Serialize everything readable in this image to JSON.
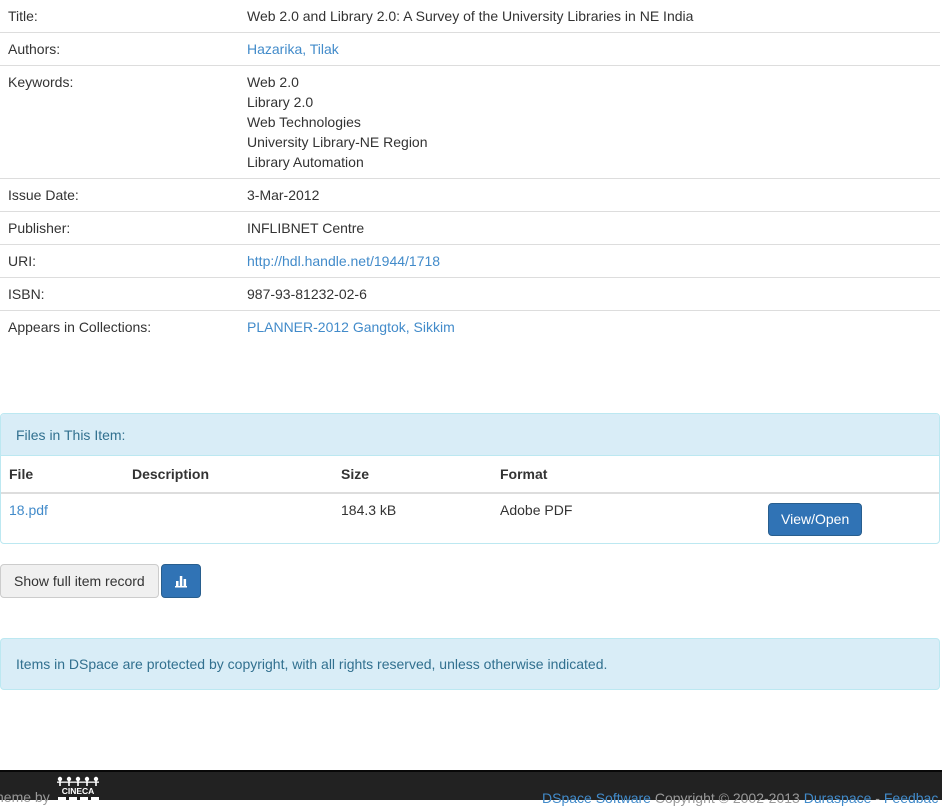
{
  "metadata": {
    "title": {
      "label": "Title:",
      "value": "Web 2.0 and Library 2.0: A Survey of the University Libraries in NE India"
    },
    "authors": {
      "label": "Authors:",
      "value": "Hazarika, Tilak"
    },
    "keywords": {
      "label": "Keywords:",
      "values": [
        "Web 2.0",
        "Library 2.0",
        "Web Technologies",
        "University Library-NE Region",
        "Library Automation"
      ]
    },
    "issue_date": {
      "label": "Issue Date:",
      "value": "3-Mar-2012"
    },
    "publisher": {
      "label": "Publisher:",
      "value": "INFLIBNET Centre"
    },
    "uri": {
      "label": "URI:",
      "value": "http://hdl.handle.net/1944/1718"
    },
    "isbn": {
      "label": "ISBN:",
      "value": "987-93-81232-02-6"
    },
    "collections": {
      "label": "Appears in Collections:",
      "value": "PLANNER-2012 Gangtok, Sikkim"
    }
  },
  "files": {
    "heading": "Files in This Item:",
    "columns": [
      "File",
      "Description",
      "Size",
      "Format"
    ],
    "rows": [
      {
        "file": "18.pdf",
        "description": "",
        "size": "184.3 kB",
        "format": "Adobe PDF",
        "action": "View/Open"
      }
    ]
  },
  "actions": {
    "show_full_record": "Show full item record",
    "stats_icon": "bar-chart-icon"
  },
  "notice": "Items in DSpace are protected by copyright, with all rights reserved, unless otherwise indicated.",
  "footer": {
    "theme_by": "heme by",
    "logo_text": "CINECA",
    "dspace_link": "DSpace Software",
    "copyright": " Copyright © 2002-2013 ",
    "duraspace_link": "Duraspace",
    "separator": " - ",
    "feedback_link": "Feedbac"
  },
  "colors": {
    "link": "#428bca",
    "primary": "#3073b5",
    "info_bg": "#d9edf7",
    "info_text": "#31708f",
    "footer_bg": "#222222"
  }
}
